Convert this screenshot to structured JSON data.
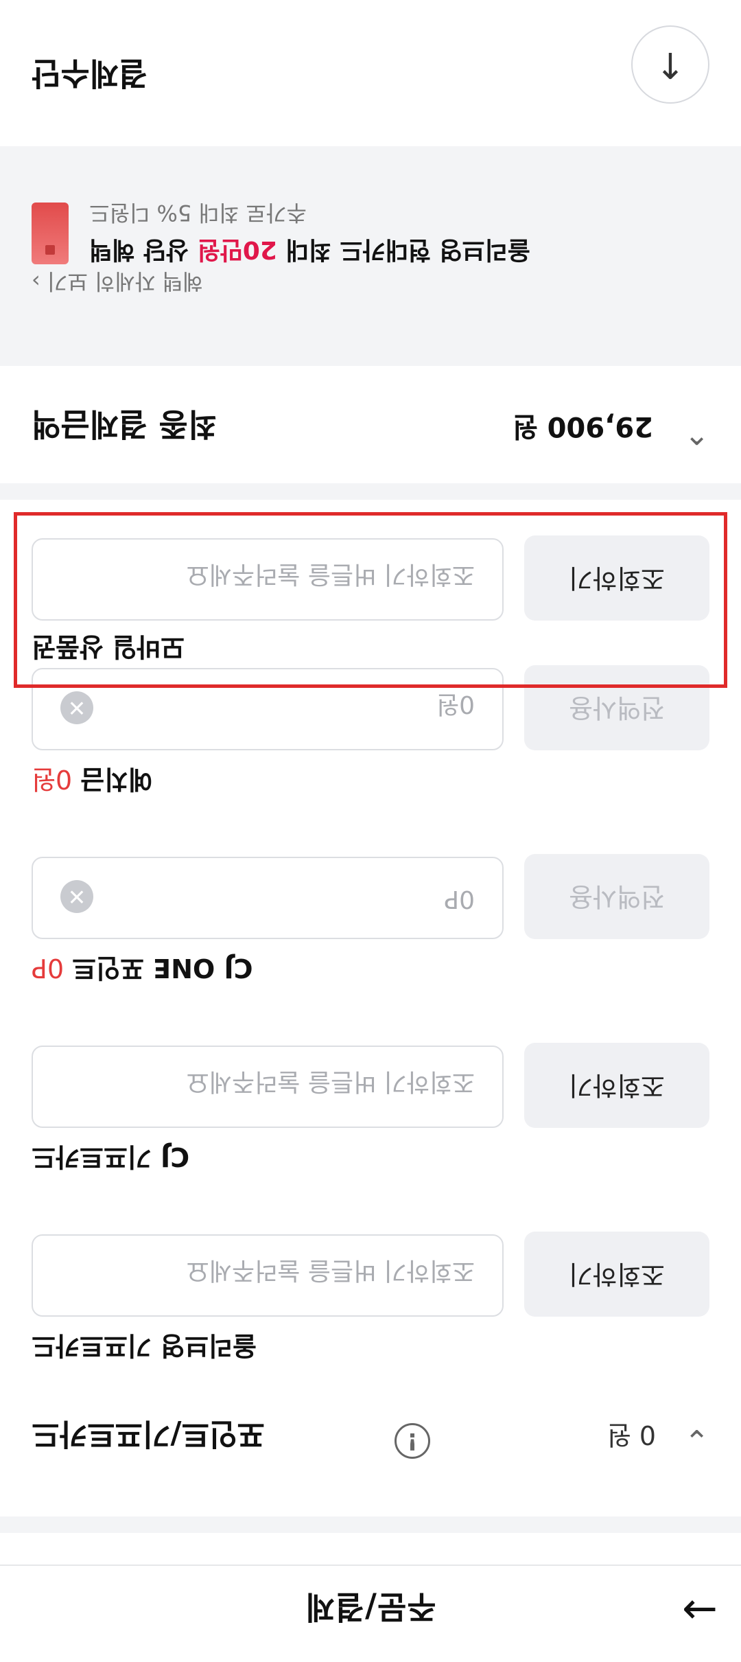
{
  "bottom_bar": {
    "label": "주문/결제",
    "arrow": "→"
  },
  "points": {
    "title": "포인트/기프트카드",
    "amount": "0 원",
    "info_icon": "!",
    "chevron": "⌄"
  },
  "fields": [
    {
      "label": "올리브영 기프트카드",
      "placeholder": "조회하기 버튼을 눌러주세요",
      "button": "조회하기"
    },
    {
      "label": "CJ 기프트카드",
      "placeholder": "조회하기 버튼을 눌러주세요",
      "button": "조회하기"
    },
    {
      "label": "CJ ONE 포인트",
      "value_label": "0P",
      "placeholder": "0P",
      "button": "전액사용"
    },
    {
      "label": "예치금",
      "value_label": "0원",
      "placeholder": "0원",
      "button": "전액사용"
    },
    {
      "label": "모바일 상품권",
      "placeholder": "조회하기 버튼을 눌러주세요",
      "button": "조회하기"
    }
  ],
  "final": {
    "title": "최종 결제금액",
    "amount": "29,900 원",
    "chevron": "⌃"
  },
  "promo": {
    "title_pre": "올리브영 현대카드 최대 ",
    "title_highlight": "20만원",
    "title_post": " 상당 혜택",
    "subtitle": "추가로 최대 5% 디원드",
    "link": "혜택 자세히 보기 ›"
  },
  "method": {
    "title": "결제수단",
    "collapse_icon": "↑"
  }
}
